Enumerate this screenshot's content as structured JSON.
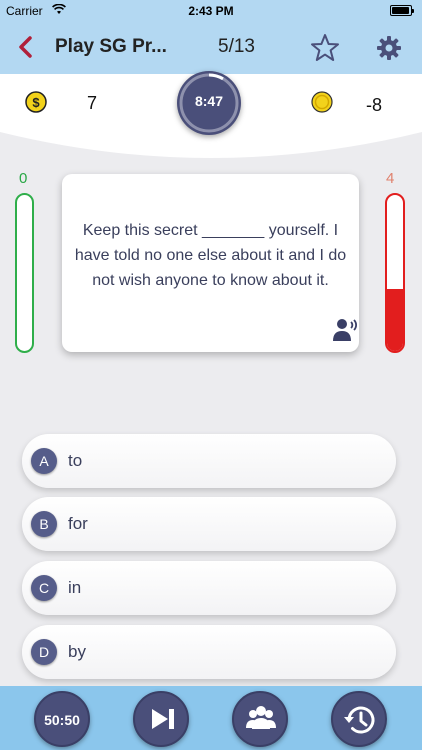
{
  "status_bar": {
    "carrier": "Carrier",
    "time": "2:43 PM"
  },
  "nav": {
    "title": "Play SG Pr...",
    "progress": "5/13"
  },
  "scores": {
    "coins": "7",
    "timer": "8:47",
    "tokens": "-8"
  },
  "meters": {
    "left_value": "0",
    "right_value": "4",
    "right_fill_fraction": 0.4
  },
  "question": {
    "text": "Keep this secret _______ yourself. I have told no one else about it and I do not wish anyone to know about it."
  },
  "answers": [
    {
      "letter": "A",
      "text": "to"
    },
    {
      "letter": "B",
      "text": "for"
    },
    {
      "letter": "C",
      "text": "in"
    },
    {
      "letter": "D",
      "text": "by"
    }
  ],
  "tools": {
    "fifty_fifty": "50:50"
  },
  "colors": {
    "nav_bg": "#b3d8f2",
    "bottom_bar_bg": "#8bc6ec",
    "accent": "#4a4f7a",
    "meter_green": "#2fae4a",
    "meter_red": "#e21e1e"
  }
}
